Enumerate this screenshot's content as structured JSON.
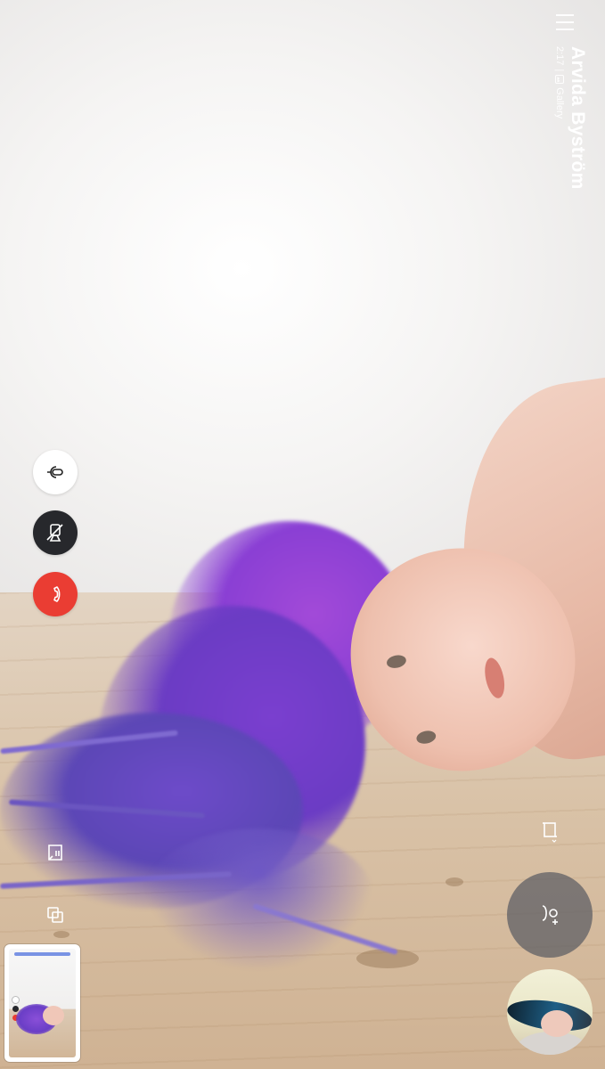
{
  "call": {
    "caller_name": "Arvida Byström",
    "duration": "2:17",
    "separator": "|",
    "source_label": "Gallery"
  },
  "icons": {
    "menu": "hamburger-menu-icon",
    "gallery": "gallery-icon",
    "microphone": "microphone-icon",
    "camera_off": "camera-off-icon",
    "end_call": "phone-hangup-icon",
    "document": "document-icon",
    "layers": "layers-icon",
    "crop": "crop-icon",
    "add_person": "add-person-icon"
  },
  "colors": {
    "end_call": "#ea3d33",
    "camera_button": "#27282c",
    "mic_button": "#ffffff",
    "add_person_bg": "#5a5c62"
  }
}
